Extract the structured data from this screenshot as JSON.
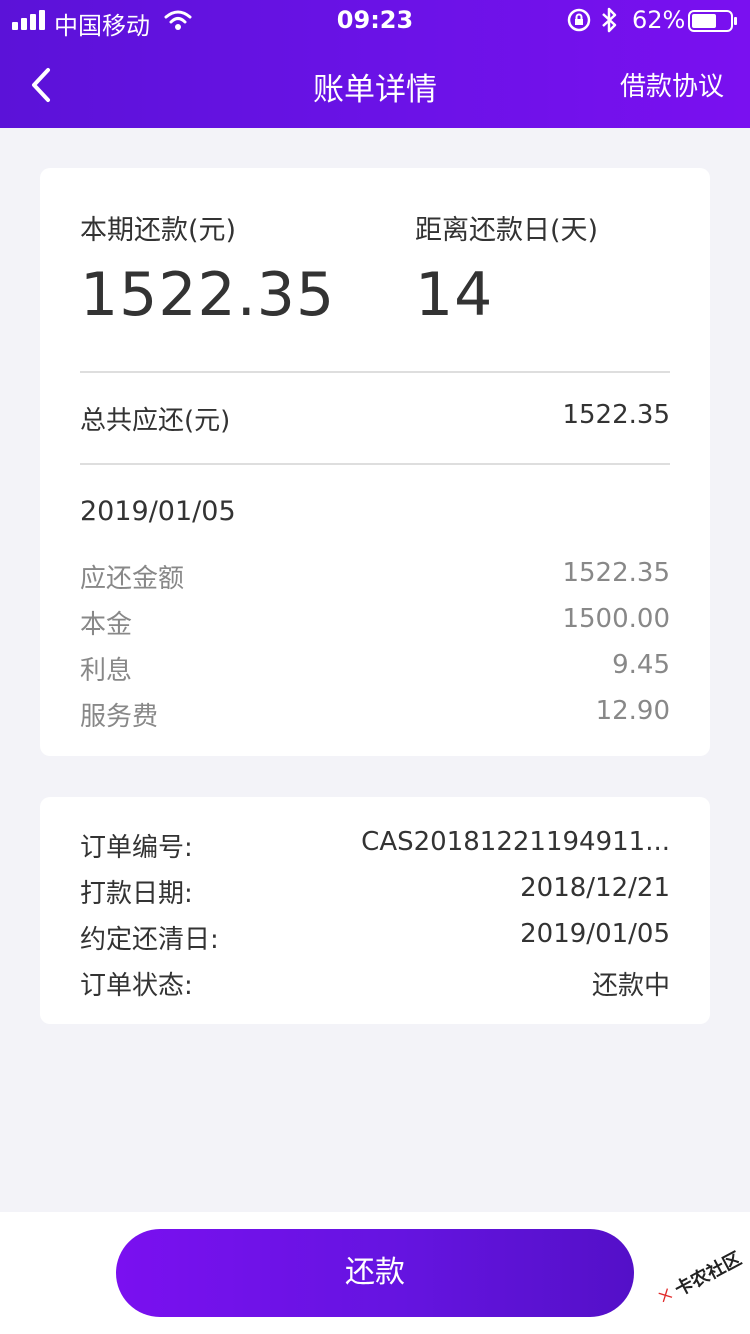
{
  "status_bar": {
    "carrier": "中国移动",
    "time": "09:23",
    "battery": "62%"
  },
  "nav": {
    "title": "账单详情",
    "action": "借款协议",
    "back_icon": "chevron-left-icon"
  },
  "summary": {
    "current_label": "本期还款(元)",
    "current_value": "1522.35",
    "days_label": "距离还款日(天)",
    "days_value": "14"
  },
  "total": {
    "label": "总共应还(元)",
    "value": "1522.35"
  },
  "installment": {
    "date": "2019/01/05",
    "items": [
      {
        "label": "应还金额",
        "value": "1522.35"
      },
      {
        "label": "本金",
        "value": "1500.00"
      },
      {
        "label": "利息",
        "value": "9.45"
      },
      {
        "label": "服务费",
        "value": "12.90"
      }
    ]
  },
  "order": {
    "items": [
      {
        "label": "订单编号:",
        "value": "CAS20181221194911..."
      },
      {
        "label": "打款日期:",
        "value": "2018/12/21"
      },
      {
        "label": "约定还清日:",
        "value": "2019/01/05"
      },
      {
        "label": "订单状态:",
        "value": "还款中"
      }
    ]
  },
  "footer": {
    "button_label": "还款"
  },
  "watermark": {
    "text": "卡农社区"
  },
  "colors": {
    "header_start": "#5b12d8",
    "header_end": "#7a10f0",
    "background": "#f3f3f8",
    "button_start": "#7a10f0",
    "button_end": "#5410c8"
  }
}
